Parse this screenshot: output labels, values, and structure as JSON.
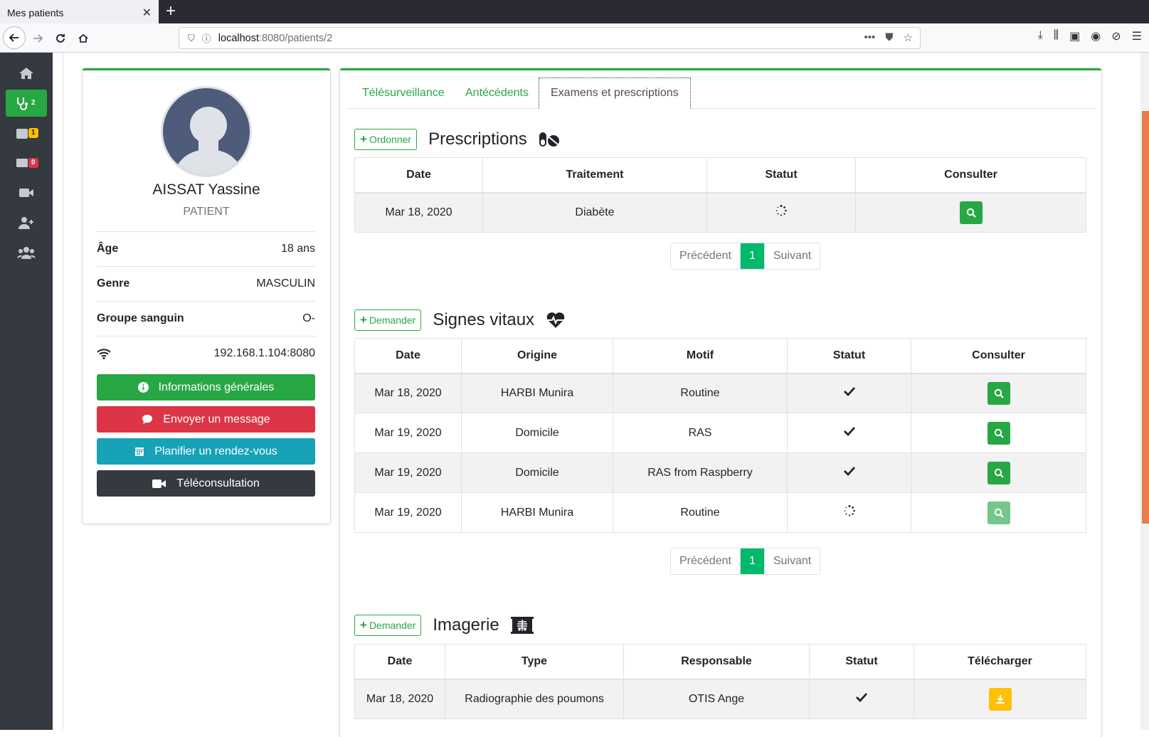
{
  "browser": {
    "tab_title": "Mes patients",
    "url_host": "localhost",
    "url_rest": ":8080/patients/2"
  },
  "sidebar": {
    "items": [
      {
        "icon": "home-icon"
      },
      {
        "icon": "stethoscope-icon",
        "badge": "2"
      },
      {
        "icon": "calendar-icon",
        "badge": "1"
      },
      {
        "icon": "envelope-icon",
        "badge": "0"
      },
      {
        "icon": "video-icon"
      },
      {
        "icon": "user-plus-icon"
      },
      {
        "icon": "users-icon"
      }
    ]
  },
  "patient": {
    "name": "AISSAT Yassine",
    "role": "PATIENT",
    "info": [
      {
        "label": "Âge",
        "value": "18 ans"
      },
      {
        "label": "Genre",
        "value": "MASCULIN"
      },
      {
        "label": "Groupe sanguin",
        "value": "O-"
      },
      {
        "label": "",
        "value": "192.168.1.104:8080"
      }
    ],
    "buttons": {
      "info": "Informations générales",
      "message": "Envoyer un message",
      "appointment": "Planifier un rendez-vous",
      "teleconsult": "Téléconsultation"
    }
  },
  "tabs": [
    "Télésurveillance",
    "Antécédents",
    "Examens et prescriptions"
  ],
  "prescriptions": {
    "button": "Ordonner",
    "title": "Prescriptions",
    "headers": [
      "Date",
      "Traitement",
      "Statut",
      "Consulter"
    ],
    "rows": [
      {
        "date": "Mar 18, 2020",
        "treatment": "Diabète",
        "status": "pending"
      }
    ],
    "pager": {
      "prev": "Précédent",
      "page": "1",
      "next": "Suivant"
    }
  },
  "vitals": {
    "button": "Demander",
    "title": "Signes vitaux",
    "headers": [
      "Date",
      "Origine",
      "Motif",
      "Statut",
      "Consulter"
    ],
    "rows": [
      {
        "date": "Mar 18, 2020",
        "origin": "HARBI Munira",
        "motive": "Routine",
        "status": "done"
      },
      {
        "date": "Mar 19, 2020",
        "origin": "Domicile",
        "motive": "RAS",
        "status": "done"
      },
      {
        "date": "Mar 19, 2020",
        "origin": "Domicile",
        "motive": "RAS from Raspberry",
        "status": "done"
      },
      {
        "date": "Mar 19, 2020",
        "origin": "HARBI Munira",
        "motive": "Routine",
        "status": "pending"
      }
    ],
    "pager": {
      "prev": "Précédent",
      "page": "1",
      "next": "Suivant"
    }
  },
  "imaging": {
    "button": "Demander",
    "title": "Imagerie",
    "headers": [
      "Date",
      "Type",
      "Responsable",
      "Statut",
      "Télécharger"
    ],
    "rows": [
      {
        "date": "Mar 18, 2020",
        "type": "Radiographie des poumons",
        "responsible": "OTIS Ange",
        "status": "done"
      }
    ]
  },
  "colors": {
    "accent": "#28a745",
    "sidebar": "#343a40",
    "danger": "#dc3545",
    "info": "#17a2b8",
    "warning": "#ffc107",
    "pager_active": "#00b96b"
  }
}
